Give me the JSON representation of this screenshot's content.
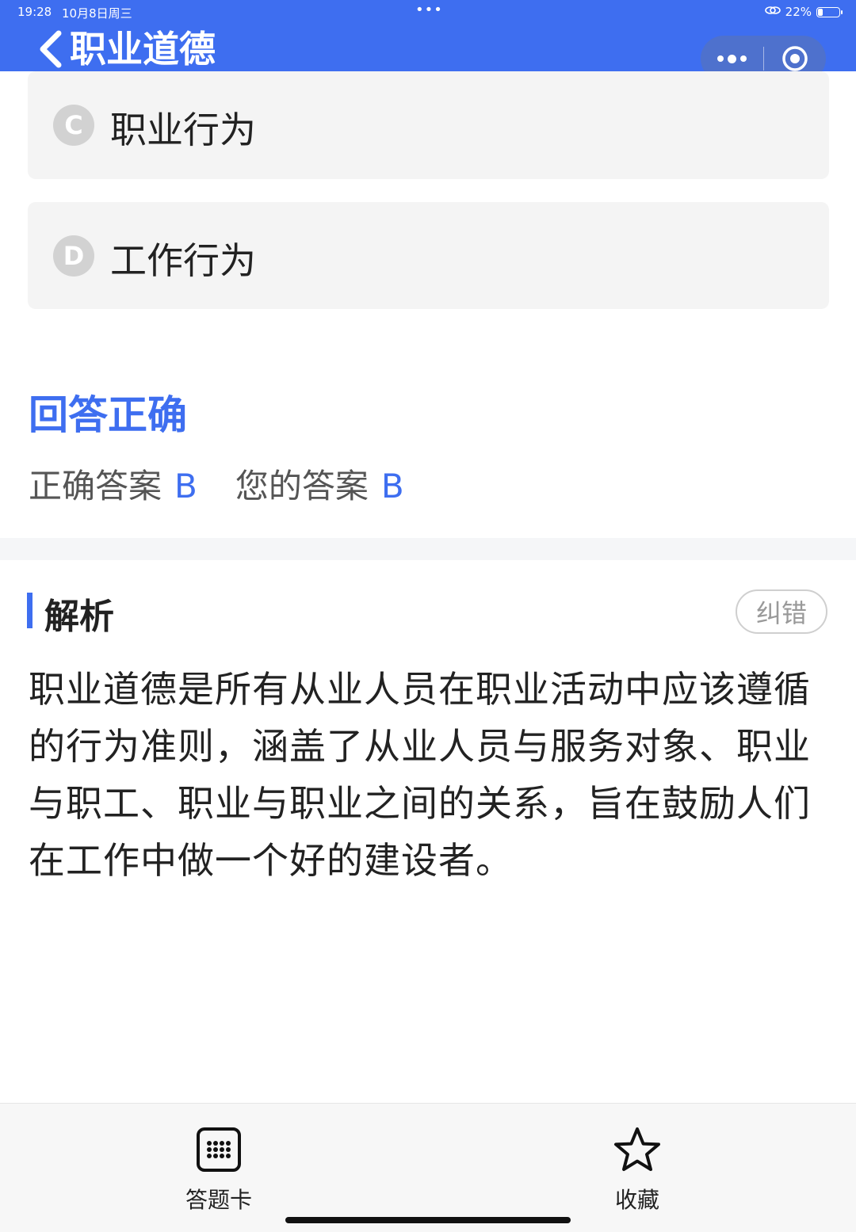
{
  "status_bar": {
    "time": "19:28",
    "date": "10月8日周三",
    "dots": "•••",
    "battery_text": "22%",
    "battery_level": 0.22
  },
  "nav": {
    "title": "职业道德",
    "accent_color": "#3e6ef0"
  },
  "options": [
    {
      "letter": "C",
      "text": "职业行为"
    },
    {
      "letter": "D",
      "text": "工作行为"
    }
  ],
  "result": {
    "title": "回答正确",
    "correct_label": "正确答案",
    "correct_value": "B",
    "yours_label": "您的答案",
    "yours_value": "B"
  },
  "analysis": {
    "title": "解析",
    "report_button": "纠错",
    "body": "职业道德是所有从业人员在职业活动中应该遵循的行为准则，涵盖了从业人员与服务对象、职业与职工、职业与职业之间的关系，旨在鼓励人们在工作中做一个好的建设者。"
  },
  "bottom_bar": {
    "answer_card_label": "答题卡",
    "favorite_label": "收藏"
  }
}
